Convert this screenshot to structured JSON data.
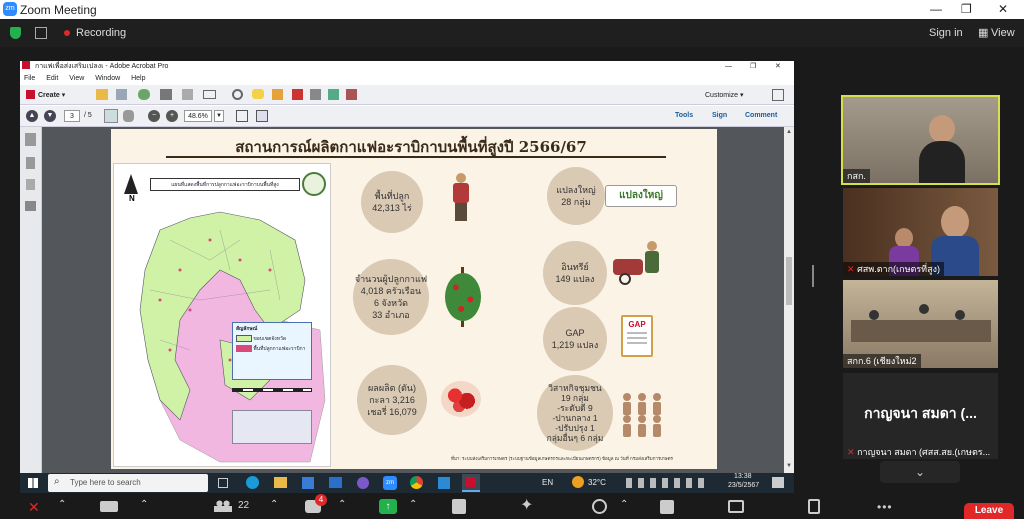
{
  "window": {
    "title": "Zoom Meeting",
    "minimize": "—",
    "maximize": "❐",
    "close": "✕"
  },
  "zoom_bar": {
    "recording": "Recording",
    "sign_in": "Sign in",
    "view": "View"
  },
  "acrobat": {
    "title": "กาแฟเพื่อส่งเสริมเปลงเ - Adobe Acrobat Pro",
    "menu": [
      "File",
      "Edit",
      "View",
      "Window",
      "Help"
    ],
    "create_label": "Create",
    "customize_label": "Customize",
    "page_current": "3",
    "page_total": "/ 5",
    "zoom": "48.6%",
    "panels": [
      "Tools",
      "Sign",
      "Comment"
    ]
  },
  "slide": {
    "title": "สถานการณ์ผลิตกาแฟอะราบิกาบนพื้นที่สูงปี 2566/67",
    "map_heading": "แผนที่แสดงพื้นที่การปลูกกาแฟอะราบิกาบนพื้นที่สูง",
    "map_legend_title": "สัญลักษณ์",
    "map_legend_items": [
      "ขอบเขตจังหวัด",
      "พื้นที่ปลูกกาแฟอะราบิกา"
    ],
    "left_stats": [
      {
        "lines": [
          "พื้นที่ปลูก",
          "42,313 ไร่"
        ]
      },
      {
        "lines": [
          "จำนวนผู้ปลูกกาแฟ",
          "4,018 ครัวเรือน",
          "6 จังหวัด",
          "33 อำเภอ"
        ]
      },
      {
        "lines": [
          "ผลผลิต (ตัน)",
          "กะลา 3,216",
          "เชอรี่ 16,079"
        ]
      }
    ],
    "right_stats": [
      {
        "lines": [
          "แปลงใหญ่",
          "28 กลุ่ม"
        ]
      },
      {
        "lines": [
          "อินทรีย์",
          "149 แปลง"
        ]
      },
      {
        "lines": [
          "GAP",
          "1,219 แปลง"
        ]
      },
      {
        "lines": [
          "วิสาหกิจชุมชน",
          "19 กลุ่ม",
          "-ระดับดี 9",
          "-ปานกลาง 1",
          "-ปรับปรุง 1",
          "กลุ่มอื่นๆ 6 กลุ่ม"
        ]
      }
    ],
    "plangyai_logo": "แปลงใหญ่",
    "gap_label": "GAP",
    "source_note": "ที่มา: ระบบส่งเสริมการเกษตร (ระบบฐานข้อมูลเกษตรกรและทะเบียนเกษตรกร) ข้อมูล ณ วันที่ กรมส่งเสริมการเกษตร"
  },
  "participants": [
    {
      "name": "กสก.",
      "active": true
    },
    {
      "name": "ศสพ.ตาก(เกษตรที่สูง)",
      "active": false
    },
    {
      "name": "สกก.6 (เชียงใหม่2",
      "active": false
    },
    {
      "name": "กาญจนา สมดา (ศสส.สย.(เกษตร...",
      "display": "กาญจนา สมดา (...",
      "active": false
    }
  ],
  "taskbar": {
    "search_placeholder": "Type here to search",
    "language": "EN",
    "weather": "32°C",
    "time": "13:38",
    "date": "23/5/2567"
  },
  "meeting_toolbar": {
    "participants_count": "22",
    "chat_badge": "4",
    "leave": "Leave"
  },
  "colors": {
    "zoom_blue": "#2D8CFF",
    "leave_red": "#E02828",
    "active_border": "#D6E04A",
    "pink_region": "#F2B7E0",
    "green_region": "#CFF2A6",
    "circle": "#DAC9B3"
  }
}
